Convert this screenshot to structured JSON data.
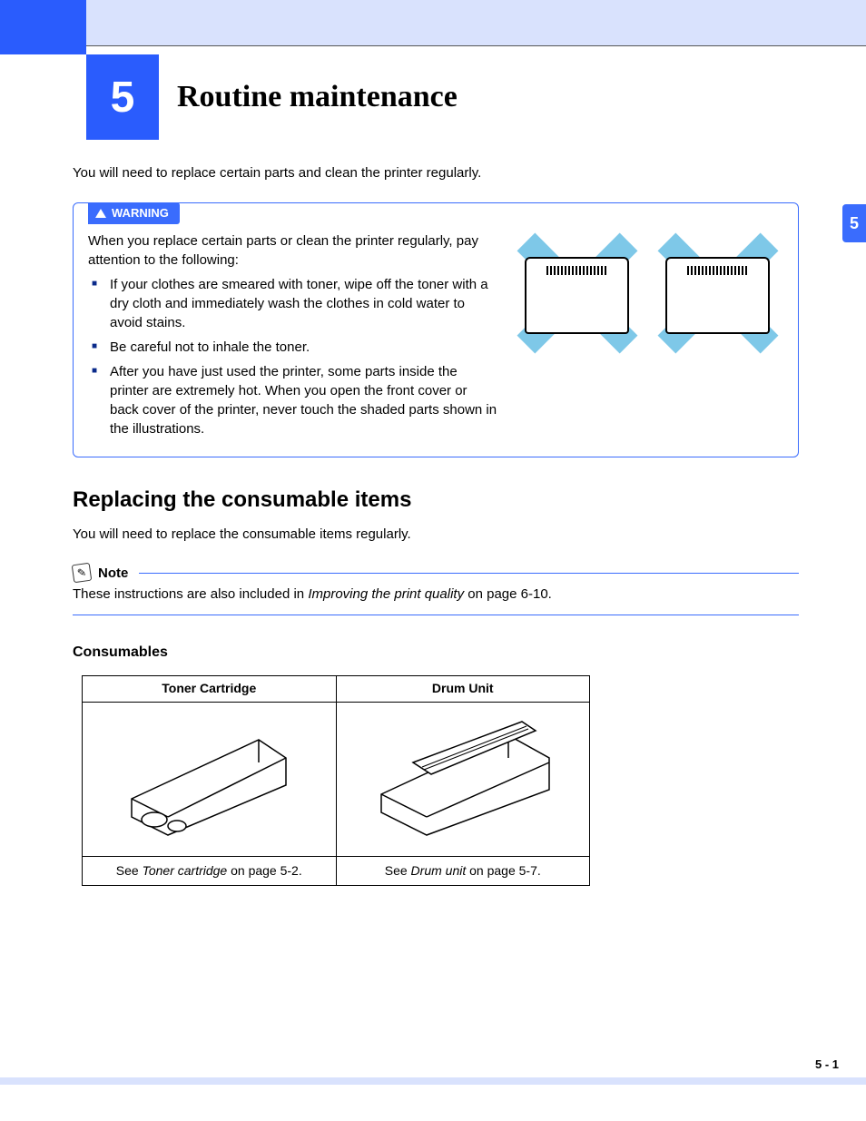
{
  "chapter": {
    "number": "5",
    "title": "Routine maintenance"
  },
  "sideTab": "5",
  "intro": "You will need to replace certain parts and clean the printer regularly.",
  "warning": {
    "label": "WARNING",
    "lead": "When you replace certain parts or clean the printer regularly, pay attention to the following:",
    "items": [
      "If your clothes are smeared with toner, wipe off the toner with a dry cloth and immediately wash the clothes in cold water to avoid stains.",
      "Be careful not to inhale the toner.",
      "After you have just used the printer, some parts inside the printer are extremely hot. When you open the front cover or back cover of the printer, never touch the shaded parts shown in the illustrations."
    ]
  },
  "section": {
    "title": "Replacing the consumable items",
    "text": "You will need to replace the consumable items regularly."
  },
  "note": {
    "label": "Note",
    "text_pre": "These instructions are also included in ",
    "text_ital": "Improving the print quality",
    "text_post": " on page 6-10."
  },
  "subsection": "Consumables",
  "table": {
    "headers": [
      "Toner Cartridge",
      "Drum Unit"
    ],
    "captions": {
      "toner_pre": "See ",
      "toner_ital": "Toner cartridge",
      "toner_post": " on page 5-2.",
      "drum_pre": "See ",
      "drum_ital": "Drum unit",
      "drum_post": " on page 5-7."
    }
  },
  "pageNumber": "5 - 1"
}
